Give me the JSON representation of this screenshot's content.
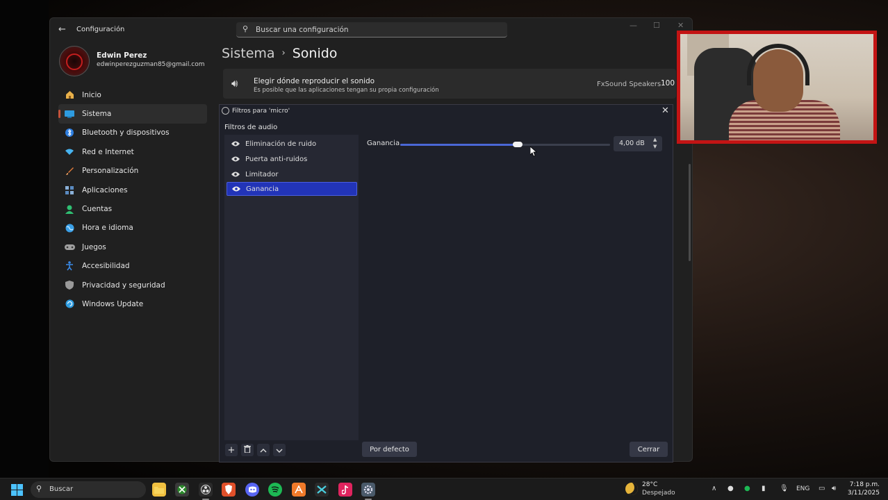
{
  "window": {
    "app_title": "Configuración",
    "search_placeholder": "Buscar una configuración"
  },
  "user": {
    "name": "Edwin Perez",
    "email": "edwinperezguzman85@gmail.com"
  },
  "sidebar": {
    "items": [
      {
        "label": "Inicio",
        "icon": "home-icon",
        "color": "#e8b04a"
      },
      {
        "label": "Sistema",
        "icon": "system-icon",
        "color": "#2e9ce0",
        "active": true
      },
      {
        "label": "Bluetooth y dispositivos",
        "icon": "bluetooth-icon",
        "color": "#2e7ee0"
      },
      {
        "label": "Red e Internet",
        "icon": "wifi-icon",
        "color": "#47b3f0"
      },
      {
        "label": "Personalización",
        "icon": "brush-icon",
        "color": "#e07a3a"
      },
      {
        "label": "Aplicaciones",
        "icon": "apps-icon",
        "color": "#8ab0d8"
      },
      {
        "label": "Cuentas",
        "icon": "account-icon",
        "color": "#2fbf72"
      },
      {
        "label": "Hora e idioma",
        "icon": "globe-icon",
        "color": "#3aa0e8"
      },
      {
        "label": "Juegos",
        "icon": "gamepad-icon",
        "color": "#a0a0a0"
      },
      {
        "label": "Accesibilidad",
        "icon": "accessibility-icon",
        "color": "#3a8ae8"
      },
      {
        "label": "Privacidad y seguridad",
        "icon": "shield-icon",
        "color": "#9a9a9a"
      },
      {
        "label": "Windows Update",
        "icon": "update-icon",
        "color": "#2e9ce0"
      }
    ]
  },
  "breadcrumb": {
    "parent": "Sistema",
    "separator": "›",
    "current": "Sonido"
  },
  "output": {
    "title": "Elegir dónde reproducir el sonido",
    "description": "Es posible que las aplicaciones tengan su propia configuración",
    "device": "FxSound Speakers",
    "volume": "100"
  },
  "dialog": {
    "title": "Filtros para 'micro'",
    "section_label": "Filtros de audio",
    "filters": [
      {
        "label": "Eliminación de ruido"
      },
      {
        "label": "Puerta anti-ruidos"
      },
      {
        "label": "Limitador"
      },
      {
        "label": "Ganancia",
        "selected": true
      }
    ],
    "gain": {
      "label": "Ganancia",
      "value_text": "4,00 dB",
      "slider_fraction": 0.56
    },
    "default_button": "Por defecto",
    "close_button": "Cerrar"
  },
  "taskbar": {
    "search_label": "Buscar",
    "weather_temp": "28°C",
    "weather_condition": "Despejado",
    "language": "ENG",
    "time": "7:18 p.m.",
    "date": "3/11/2025",
    "apps": [
      {
        "icon": "file-explorer-icon",
        "color": "#f0c040"
      },
      {
        "icon": "xbox-icon",
        "color": "#3a3a3a"
      },
      {
        "icon": "obs-icon",
        "color": "#3a3a3a",
        "active": true
      },
      {
        "icon": "brave-icon",
        "color": "#e0502a"
      },
      {
        "icon": "discord-icon",
        "color": "#5865f2"
      },
      {
        "icon": "spotify-icon",
        "color": "#1db954"
      },
      {
        "icon": "app-a-icon",
        "color": "#f07a2a"
      },
      {
        "icon": "capcut-icon",
        "color": "#2a2a2a"
      },
      {
        "icon": "tiktok-icon",
        "color": "#e0245e"
      },
      {
        "icon": "settings-icon",
        "color": "#5a6a7a",
        "active": true
      }
    ]
  }
}
